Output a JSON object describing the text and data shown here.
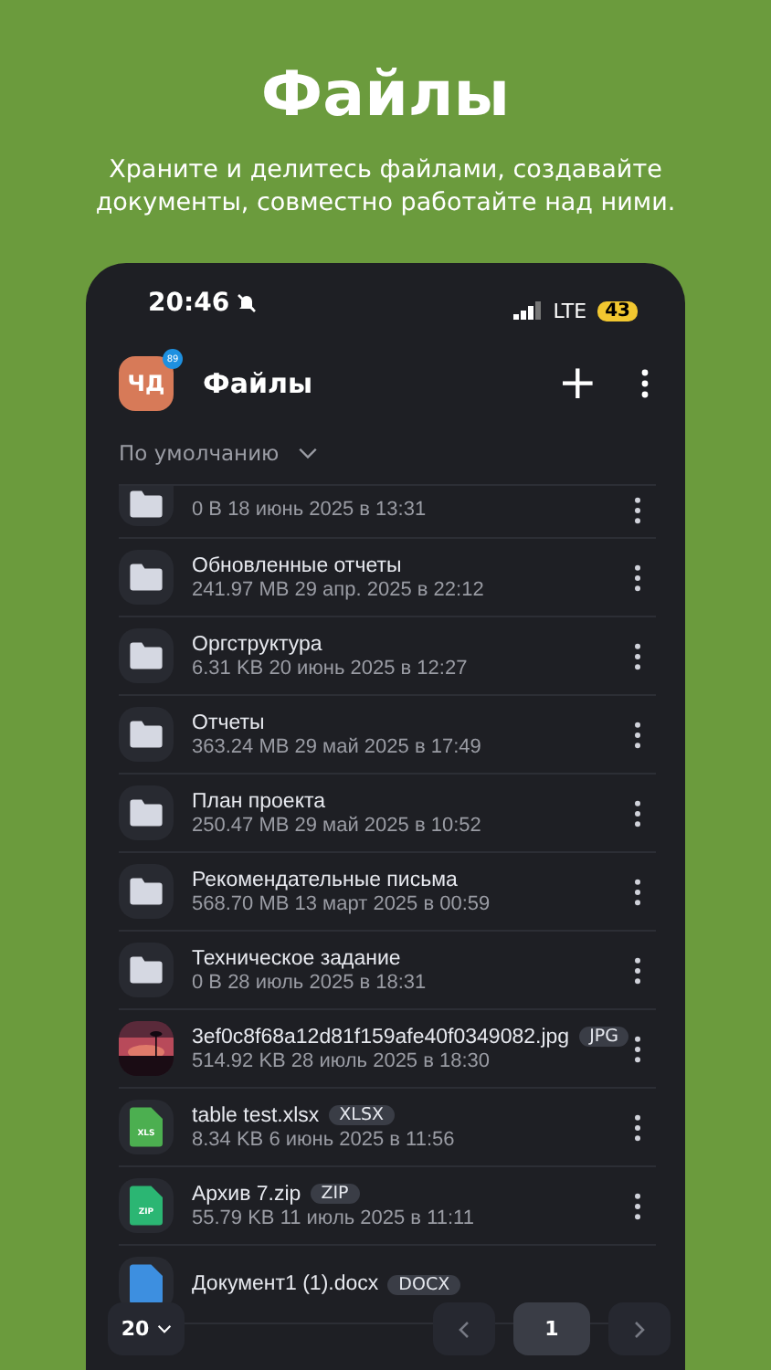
{
  "promo": {
    "title": "Файлы",
    "subtitle": "Храните и делитесь файлами, создавайте документы, совместно работайте над ними."
  },
  "status_bar": {
    "time": "20:46",
    "network": "LTE",
    "battery": "43"
  },
  "app_bar": {
    "avatar": "ЧД",
    "avatar_badge": "89",
    "title": "Файлы",
    "add": "+"
  },
  "sort": {
    "label": "По умолчанию"
  },
  "files": [
    {
      "kind": "folder",
      "meta": "0 B 18 июнь 2025 в 13:31"
    },
    {
      "kind": "folder",
      "name": "Обновленные отчеты",
      "meta": "241.97 MB 29 апр. 2025 в 22:12"
    },
    {
      "kind": "folder",
      "name": "Оргструктура",
      "meta": "6.31 KB 20 июнь 2025 в 12:27"
    },
    {
      "kind": "folder",
      "name": "Отчеты",
      "meta": "363.24 MB 29 май 2025 в 17:49"
    },
    {
      "kind": "folder",
      "name": "План проекта",
      "meta": "250.47 MB 29 май 2025 в 10:52"
    },
    {
      "kind": "folder",
      "name": "Рекомендательные письма",
      "meta": "568.70 MB 13 март 2025 в 00:59"
    },
    {
      "kind": "folder",
      "name": "Техническое задание",
      "meta": "0 B 28 июль 2025 в 18:31"
    },
    {
      "name": "3ef0c8f68a12d81f159afe40f0349082.jpg",
      "badge": "JPG",
      "meta": "514.92 KB 28 июль 2025 в 18:30"
    },
    {
      "kind": "sheet",
      "name": "table test.xlsx",
      "badge": "XLSX",
      "icon_text": "XLS",
      "meta": "8.34 KB 6 июнь 2025 в 11:56"
    },
    {
      "kind": "archive",
      "name": "Архив 7.zip",
      "badge": "ZIP",
      "icon_text": "ZIP",
      "meta": "55.79 KB 11 июль 2025 в 11:11"
    },
    {
      "kind": "doc",
      "name": "Документ1 (1).docx",
      "badge": "DOCX"
    }
  ],
  "pagination": {
    "page_size": "20",
    "page": "1"
  }
}
